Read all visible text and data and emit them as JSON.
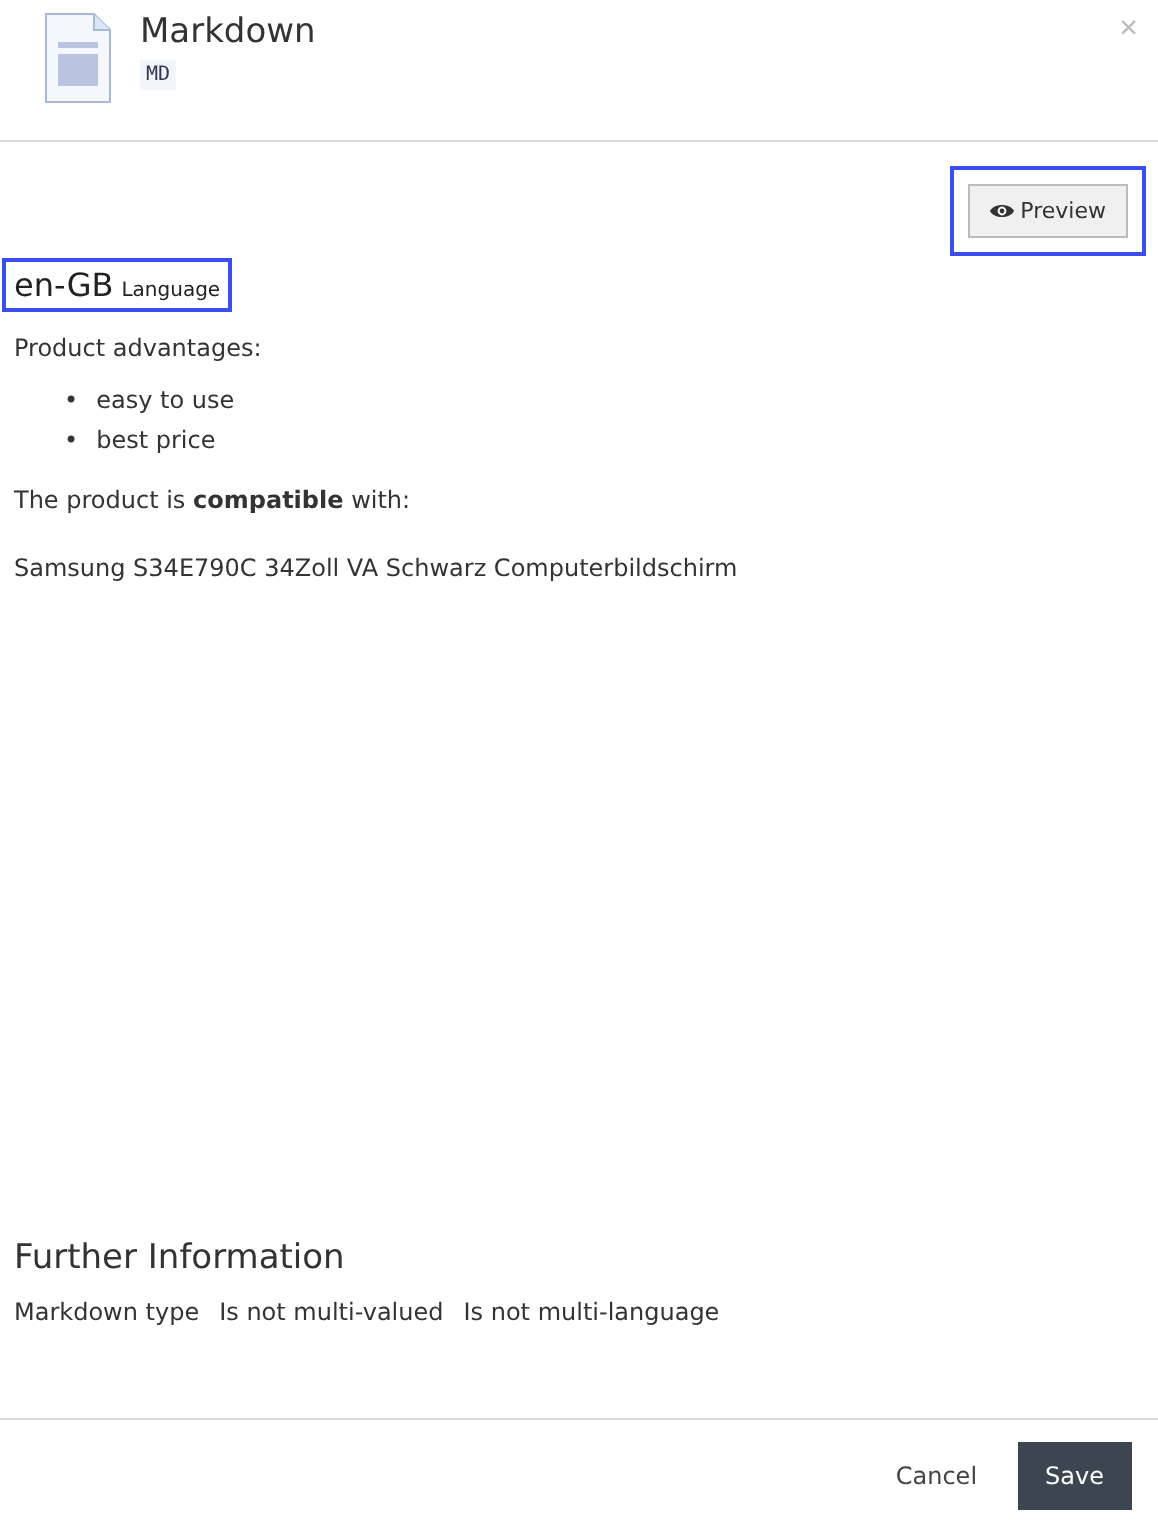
{
  "dialog": {
    "title": "Markdown",
    "badge": "MD",
    "close": "×"
  },
  "preview_button": {
    "label": "Preview",
    "highlighted": true
  },
  "language": {
    "code": "en-GB",
    "label": "Language",
    "highlighted": true
  },
  "content": [
    {
      "kind": "paragraph",
      "text": "Product advantages:"
    },
    {
      "kind": "list",
      "items": [
        {
          "bullet": "•",
          "text": "easy to use"
        },
        {
          "bullet": "•",
          "text": "best price"
        }
      ]
    },
    {
      "kind": "paragraph",
      "text": "The product is **compatible** with:"
    },
    {
      "kind": "paragraph",
      "text": "Samsung S34E790C 34Zoll VA Schwarz Computerbildschirm"
    }
  ],
  "further_information": {
    "title": "Further Information",
    "facts": [
      "Markdown type",
      "Is not multi-valued",
      "Is not multi-language"
    ]
  },
  "footer": {
    "cancel": "Cancel",
    "save": "Save"
  }
}
